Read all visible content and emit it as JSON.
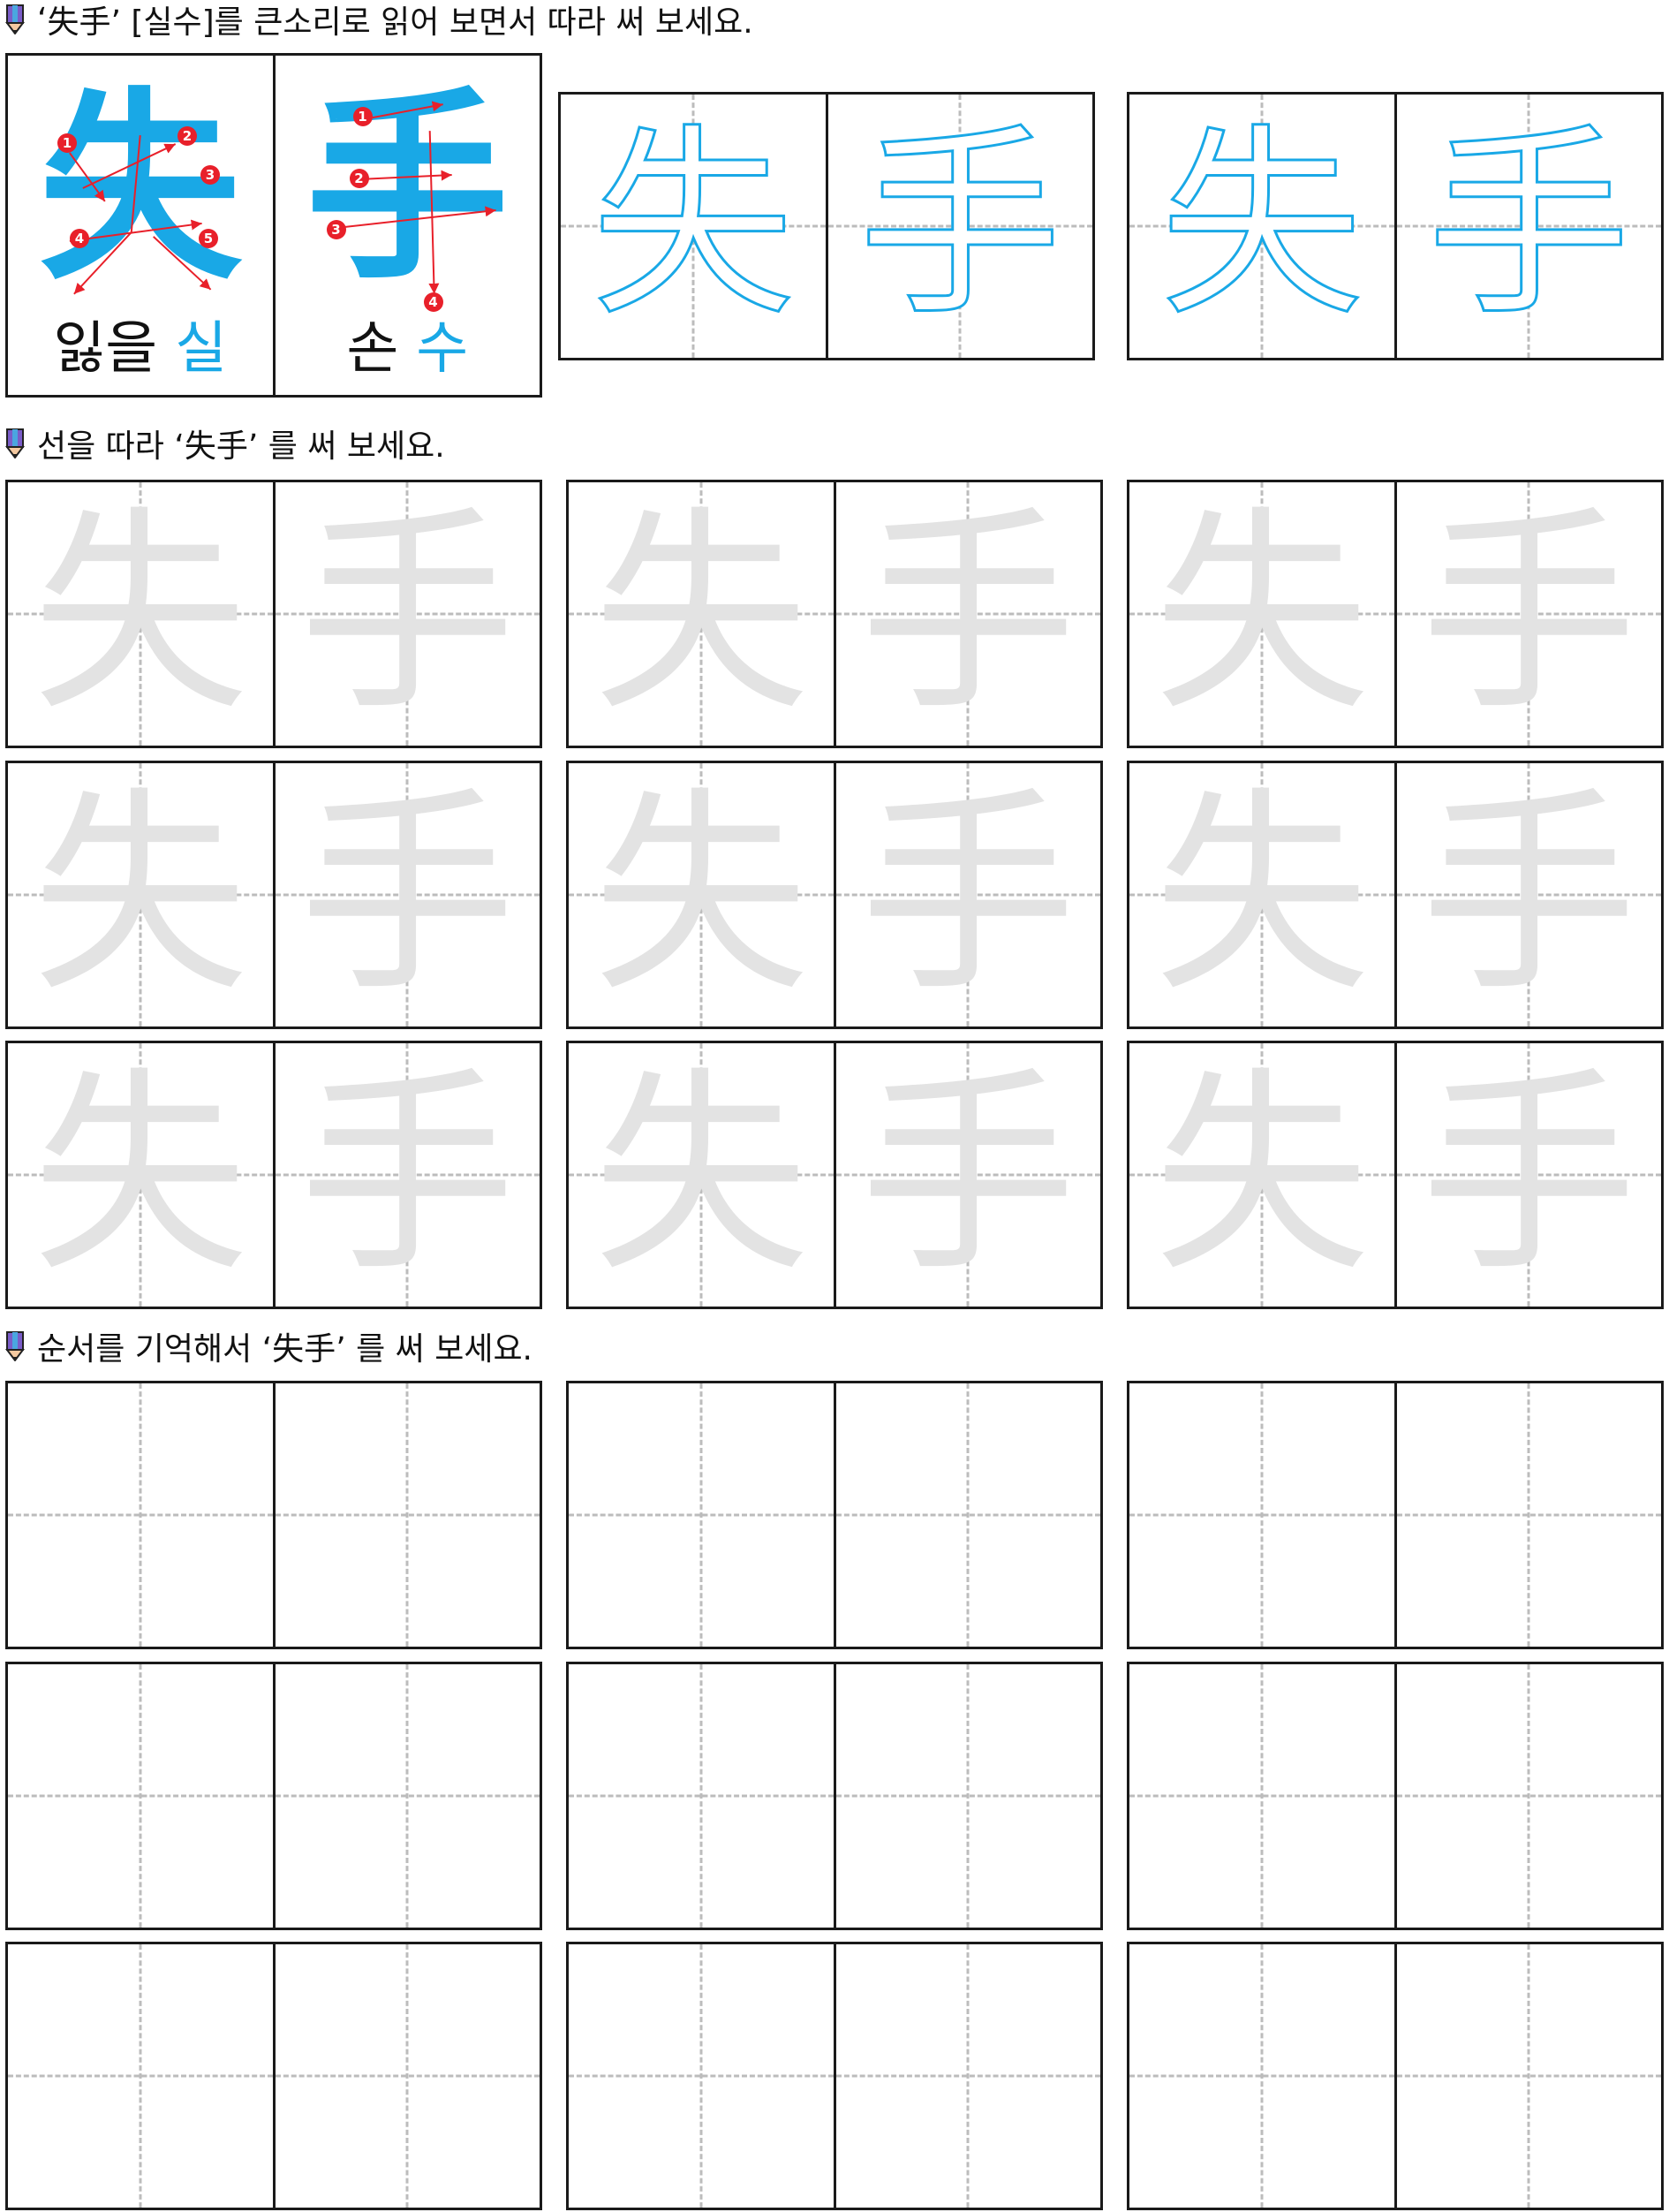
{
  "instructions": {
    "first_pre": "‘",
    "first_hanja": "失手",
    "first_post": "’ [실수]를 큰소리로 읽어 보면서 따라 써 보세요.",
    "second_pre": "선을 따라 ‘",
    "second_hanja": "失手",
    "second_post": "’ 를 써 보세요.",
    "third_pre": "순서를 기억해서 ‘",
    "third_hanja": "失手",
    "third_post": "’ 를 써 보세요."
  },
  "example": [
    {
      "char": "失",
      "meaning": "잃을",
      "reading": "실",
      "stroke_numbers": [
        "1",
        "2",
        "3",
        "4",
        "5"
      ]
    },
    {
      "char": "手",
      "meaning": "손",
      "reading": "수",
      "stroke_numbers": [
        "1",
        "2",
        "3",
        "4"
      ]
    }
  ],
  "trace_chars": [
    "失",
    "手"
  ],
  "colors": {
    "accent": "#19a8e6",
    "faint": "#e3e3e3",
    "badge": "#e8202a",
    "guide": "#bcbcbc"
  }
}
